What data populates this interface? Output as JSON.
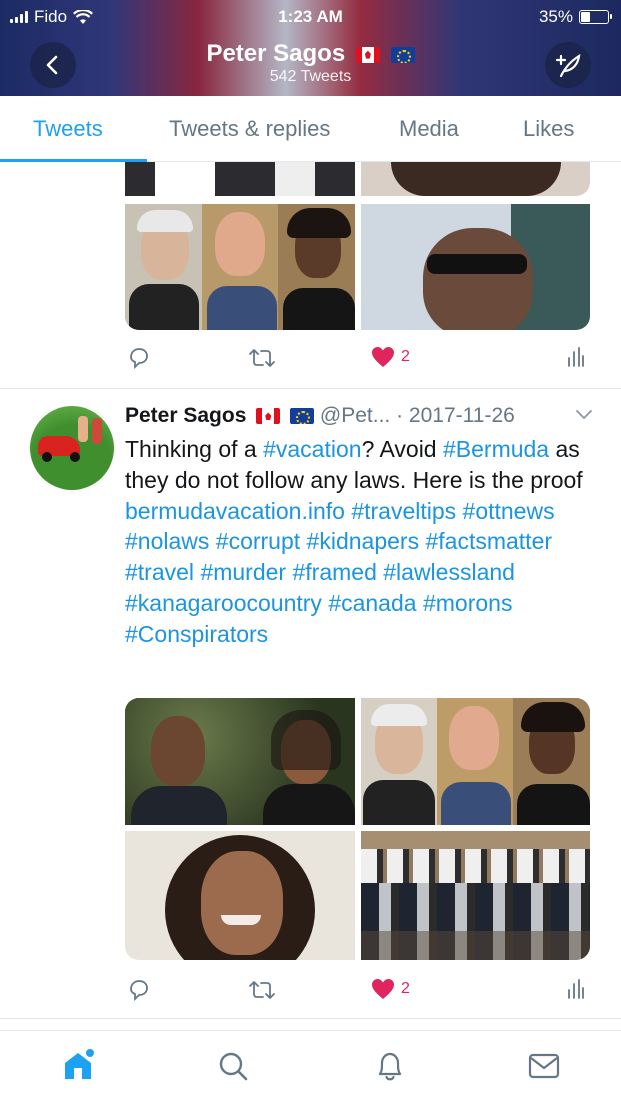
{
  "status_bar": {
    "carrier": "Fido",
    "time": "1:23 AM",
    "battery": "35%",
    "battery_level": 0.35
  },
  "header": {
    "title": "Peter Sagos",
    "subtitle": "542 Tweets"
  },
  "tabs": [
    {
      "label": "Tweets",
      "active": true
    },
    {
      "label": "Tweets & replies",
      "active": false
    },
    {
      "label": "Media",
      "active": false
    },
    {
      "label": "Likes",
      "active": false
    }
  ],
  "tweet_prev": {
    "likes": "2"
  },
  "tweet": {
    "name": "Peter Sagos",
    "handle": "@Pet...",
    "date": "· 2017-11-26",
    "text_parts": [
      {
        "text": "Thinking of a ",
        "link": false
      },
      {
        "text": "#vacation",
        "link": true
      },
      {
        "text": "? Avoid ",
        "link": false
      },
      {
        "text": "#Bermuda",
        "link": true
      },
      {
        "text": " as they do not follow any laws. Here is the proof ",
        "link": false
      },
      {
        "text": "bermudavacation.info",
        "link": true
      },
      {
        "text": " ",
        "link": false
      },
      {
        "text": "#traveltips",
        "link": true
      },
      {
        "text": " ",
        "link": false
      },
      {
        "text": "#ottnews",
        "link": true
      },
      {
        "text": " ",
        "link": false
      },
      {
        "text": "#nolaws",
        "link": true
      },
      {
        "text": " ",
        "link": false
      },
      {
        "text": "#corrupt",
        "link": true
      },
      {
        "text": " ",
        "link": false
      },
      {
        "text": "#kidnapers",
        "link": true
      },
      {
        "text": " ",
        "link": false
      },
      {
        "text": "#factsmatter",
        "link": true
      },
      {
        "text": " ",
        "link": false
      },
      {
        "text": "#travel",
        "link": true
      },
      {
        "text": " ",
        "link": false
      },
      {
        "text": "#murder",
        "link": true
      },
      {
        "text": " ",
        "link": false
      },
      {
        "text": "#framed",
        "link": true
      },
      {
        "text": " ",
        "link": false
      },
      {
        "text": "#lawlessland",
        "link": true
      },
      {
        "text": " ",
        "link": false
      },
      {
        "text": "#kanagaroocountry",
        "link": true
      },
      {
        "text": " ",
        "link": false
      },
      {
        "text": "#canada",
        "link": true
      },
      {
        "text": " ",
        "link": false
      },
      {
        "text": "#morons",
        "link": true
      },
      {
        "text": " ",
        "link": false
      },
      {
        "text": "#Conspirators",
        "link": true
      }
    ],
    "likes": "2"
  },
  "bottom_nav": [
    "home-icon",
    "search-icon",
    "notifications-icon",
    "messages-icon"
  ],
  "colors": {
    "accent": "#1da1f2",
    "link": "#1b95e0",
    "like": "#e0245e",
    "muted": "#657786"
  }
}
